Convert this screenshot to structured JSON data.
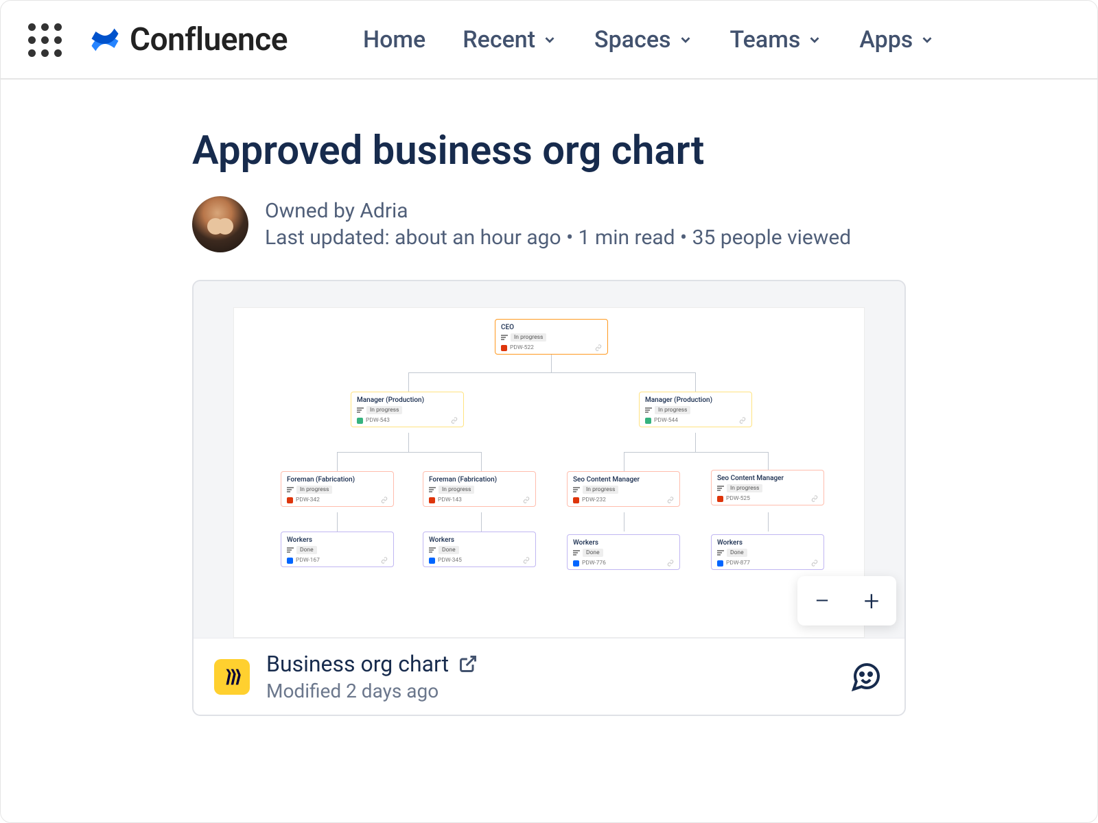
{
  "nav": {
    "brand": "Confluence",
    "items": [
      {
        "label": "Home",
        "hasDropdown": false
      },
      {
        "label": "Recent",
        "hasDropdown": true
      },
      {
        "label": "Spaces",
        "hasDropdown": true
      },
      {
        "label": "Teams",
        "hasDropdown": true
      },
      {
        "label": "Apps",
        "hasDropdown": true
      }
    ]
  },
  "page": {
    "title": "Approved business org chart",
    "owner": "Owned by Adria",
    "meta": "Last updated: about an hour ago • 1 min read • 35 people viewed"
  },
  "embed": {
    "title": "Business org chart",
    "modified": "Modified 2 days ago",
    "zoom": {
      "minus": "−",
      "plus": "+"
    }
  },
  "org": {
    "ceo": {
      "title": "CEO",
      "status": "In progress",
      "tag": "PDW-522"
    },
    "mgr1": {
      "title": "Manager (Production)",
      "status": "In progress",
      "tag": "PDW-543"
    },
    "mgr2": {
      "title": "Manager (Production)",
      "status": "In progress",
      "tag": "PDW-544"
    },
    "f1": {
      "title": "Foreman (Fabrication)",
      "status": "In progress",
      "tag": "PDW-342"
    },
    "f2": {
      "title": "Foreman (Fabrication)",
      "status": "In progress",
      "tag": "PDW-143"
    },
    "s1": {
      "title": "Seo Content Manager",
      "status": "In progress",
      "tag": "PDW-232"
    },
    "s2": {
      "title": "Seo Content Manager",
      "status": "In progress",
      "tag": "PDW-525"
    },
    "w1": {
      "title": "Workers",
      "status": "Done",
      "tag": "PDW-167"
    },
    "w2": {
      "title": "Workers",
      "status": "Done",
      "tag": "PDW-345"
    },
    "w3": {
      "title": "Workers",
      "status": "Done",
      "tag": "PDW-776"
    },
    "w4": {
      "title": "Workers",
      "status": "Done",
      "tag": "PDW-877"
    }
  }
}
